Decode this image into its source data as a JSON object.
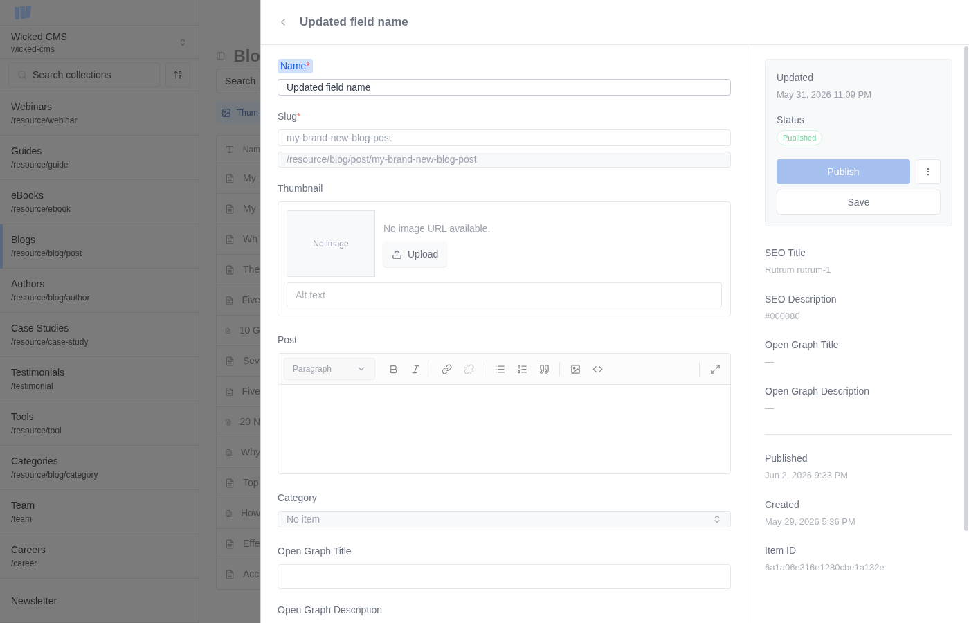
{
  "background": {
    "workspace": {
      "name": "Wicked CMS",
      "slug": "wicked-cms"
    },
    "collection_search": {
      "placeholder": "Search collections"
    },
    "collections": [
      {
        "name": "Webinars",
        "path": "/resource/webinar",
        "selected": false
      },
      {
        "name": "Guides",
        "path": "/resource/guide",
        "selected": false
      },
      {
        "name": "eBooks",
        "path": "/resource/ebook",
        "selected": false
      },
      {
        "name": "Blogs",
        "path": "/resource/blog/post",
        "selected": true
      },
      {
        "name": "Authors",
        "path": "/resource/blog/author",
        "selected": false
      },
      {
        "name": "Case Studies",
        "path": "/resource/case-study",
        "selected": false
      },
      {
        "name": "Testimonials",
        "path": "/testimonial",
        "selected": false
      },
      {
        "name": "Tools",
        "path": "/resource/tool",
        "selected": false
      },
      {
        "name": "Categories",
        "path": "/resource/blog/category",
        "selected": false
      },
      {
        "name": "Team",
        "path": "/team",
        "selected": false
      },
      {
        "name": "Careers",
        "path": "/career",
        "selected": false
      },
      {
        "name": "Newsletter",
        "selected": false
      }
    ],
    "page_title": "Blo",
    "item_search": {
      "placeholder": "Search"
    },
    "filter_chip": "Thum",
    "column_1": "Nam",
    "rows": [
      "My",
      "My",
      "Wh",
      "The",
      "Five",
      "10 G",
      "Sev",
      "Five",
      "20 N",
      "Why",
      "Top",
      "How",
      "Effe",
      "Acc"
    ]
  },
  "drawer": {
    "title": "Updated field name",
    "name": {
      "label": "Name",
      "required_mark": "*",
      "value": "Updated field name"
    },
    "slug": {
      "label": "Slug",
      "required_mark": "*",
      "value": "my-brand-new-blog-post",
      "path": "/resource/blog/post/my-brand-new-blog-post"
    },
    "thumbnail": {
      "label": "Thumbnail",
      "preview": "No image",
      "message": "No image URL available.",
      "upload": "Upload",
      "alt": {
        "placeholder": "Alt text"
      }
    },
    "post": {
      "label": "Post",
      "block_type": "Paragraph"
    },
    "category": {
      "label": "Category",
      "placeholder": "No item"
    },
    "og_title": {
      "label": "Open Graph Title"
    },
    "og_description": {
      "label": "Open Graph Description"
    },
    "side": {
      "updated": {
        "label": "Updated",
        "value": "May 31, 2026 11:09 PM"
      },
      "status": {
        "label": "Status",
        "value": "Published"
      },
      "publish": "Publish",
      "save": "Save",
      "meta": [
        {
          "label": "SEO Title",
          "value": "Rutrum rutrum-1"
        },
        {
          "label": "SEO Description",
          "value": "#000080"
        },
        {
          "label": "Open Graph Title",
          "value": "—"
        },
        {
          "label": "Open Graph Description",
          "value": "—"
        }
      ],
      "info": [
        {
          "label": "Published",
          "value": "Jun 2, 2026 9:33 PM"
        },
        {
          "label": "Created",
          "value": "May 29, 2026 5:36 PM"
        },
        {
          "label": "Item ID",
          "value": "6a1a06e316e1280cbe1a132e"
        }
      ]
    }
  }
}
